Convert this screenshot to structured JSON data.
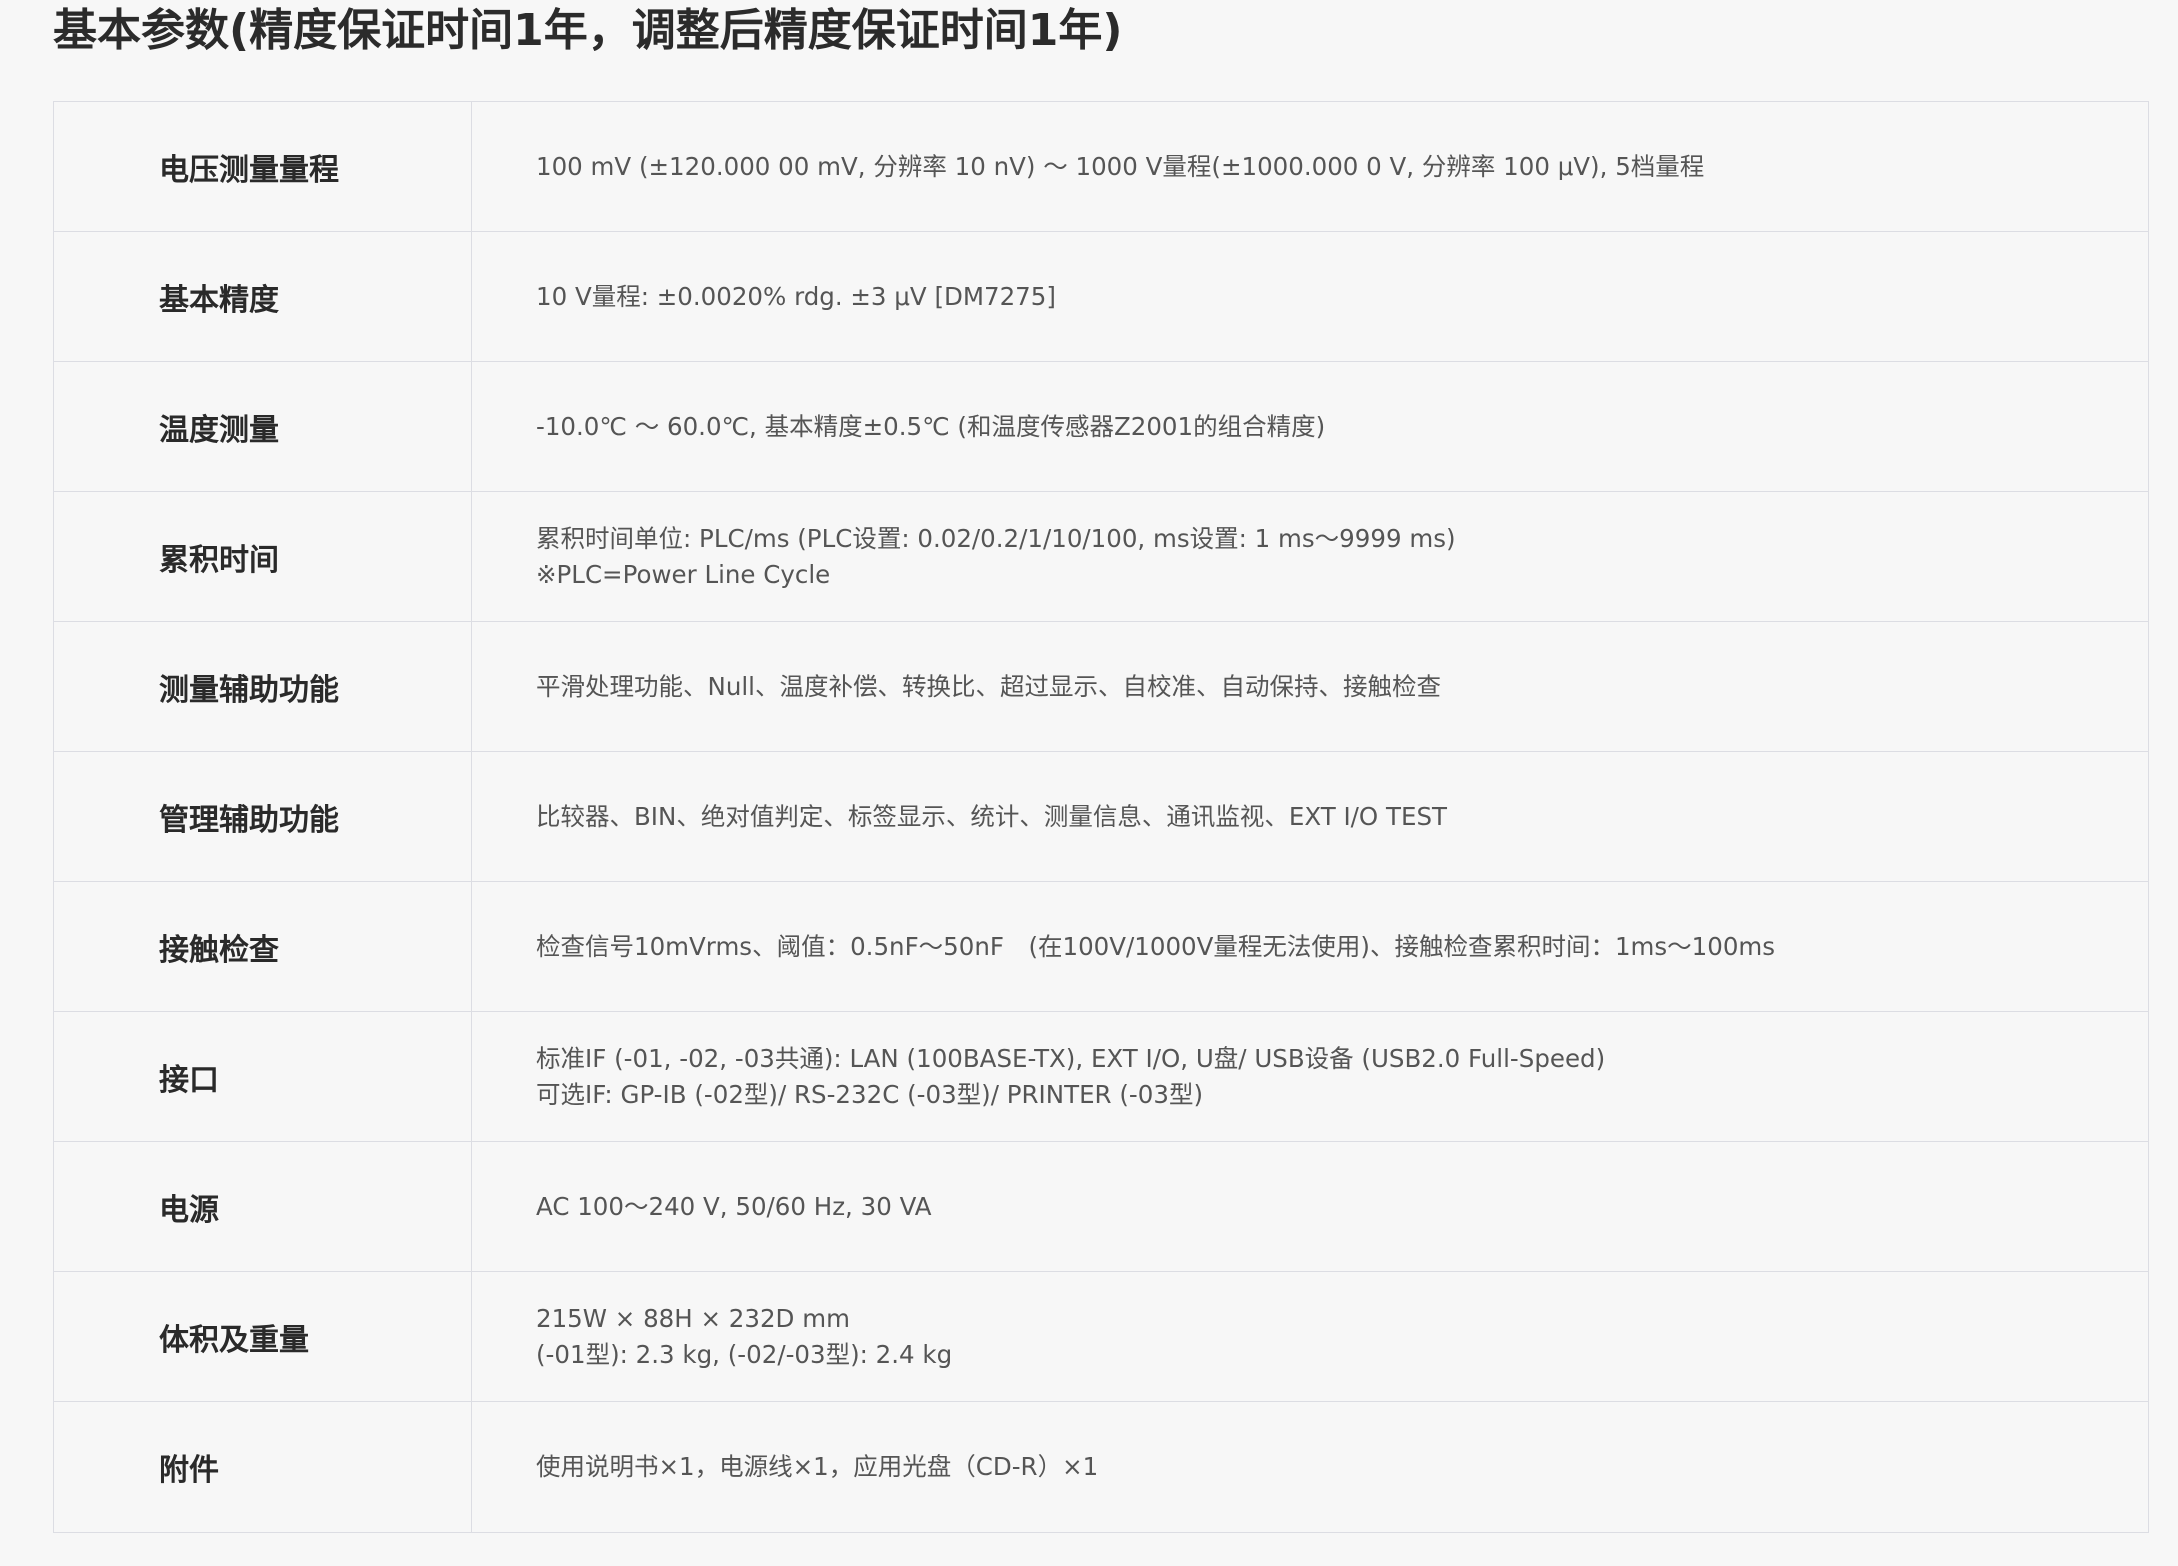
{
  "title": "基本参数(精度保证时间1年，调整后精度保证时间1年)",
  "rows": [
    {
      "label": "电压测量量程",
      "lines": [
        "100 mV (±120.000 00 mV, 分辨率 10 nV) ～ 1000 V量程(±1000.000 0 V, 分辨率 100 μV), 5档量程"
      ]
    },
    {
      "label": "基本精度",
      "lines": [
        "10 V量程: ±0.0020% rdg. ±3 μV [DM7275]"
      ]
    },
    {
      "label": "温度测量",
      "lines": [
        "-10.0℃ ～ 60.0℃, 基本精度±0.5℃ (和温度传感器Z2001的组合精度)"
      ]
    },
    {
      "label": "累积时间",
      "lines": [
        "累积时间单位: PLC/ms (PLC设置: 0.02/0.2/1/10/100, ms设置: 1 ms～9999 ms)",
        "※PLC=Power Line Cycle"
      ]
    },
    {
      "label": "测量辅助功能",
      "lines": [
        "平滑处理功能、Null、温度补偿、转换比、超过显示、自校准、自动保持、接触检查"
      ]
    },
    {
      "label": "管理辅助功能",
      "lines": [
        "比较器、BIN、绝对值判定、标签显示、统计、测量信息、通讯监视、EXT I/O TEST"
      ]
    },
    {
      "label": "接触检查",
      "lines": [
        "检查信号10mVrms、阈值：0.5nF～50nF　(在100V/1000V量程无法使用)、接触检查累积时间：1ms～100ms"
      ]
    },
    {
      "label": "接口",
      "lines": [
        "标准IF (-01, -02, -03共通): LAN (100BASE-TX), EXT I/O, U盘/ USB设备 (USB2.0 Full-Speed)",
        "可选IF: GP-IB (-02型)/ RS-232C (-03型)/ PRINTER (-03型)"
      ]
    },
    {
      "label": "电源",
      "lines": [
        "AC 100～240 V, 50/60 Hz, 30 VA"
      ]
    },
    {
      "label": "体积及重量",
      "lines": [
        "215W × 88H × 232D mm",
        "(-01型): 2.3 kg, (-02/-03型): 2.4 kg"
      ]
    },
    {
      "label": "附件",
      "lines": [
        "使用说明书×1，电源线×1，应用光盘（CD-R）×1"
      ]
    }
  ]
}
